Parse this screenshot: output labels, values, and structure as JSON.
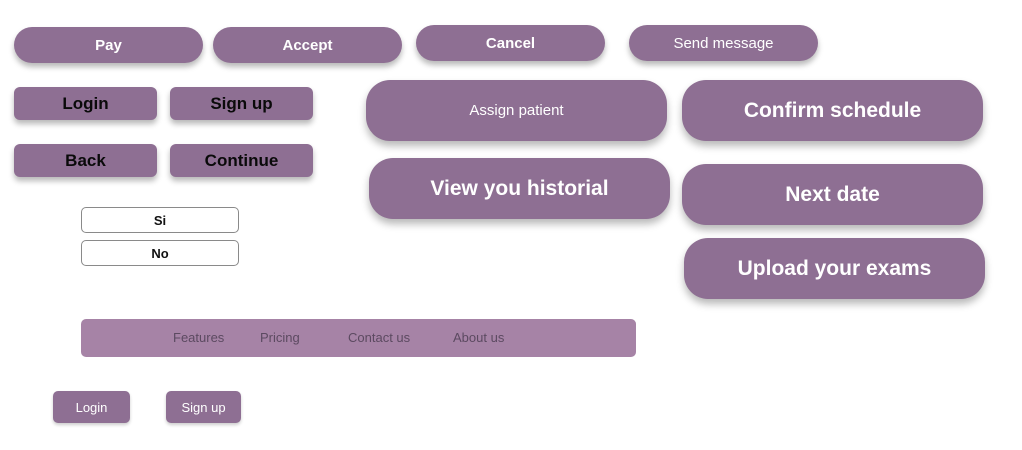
{
  "colors": {
    "button_fill": "#8e6f93",
    "navbar_fill": "#a683a6",
    "nav_text": "#5c4a61"
  },
  "top_row": {
    "pay": "Pay",
    "accept": "Accept",
    "cancel": "Cancel",
    "send_message": "Send message"
  },
  "auth": {
    "login": "Login",
    "signup": "Sign up",
    "back": "Back",
    "continue": "Continue"
  },
  "choices": {
    "yes": "Si",
    "no": "No"
  },
  "actions": {
    "assign_patient": "Assign patient",
    "view_historial": "View you historial",
    "confirm_schedule": "Confirm schedule",
    "next_date": "Next date",
    "upload_exams": "Upload your exams"
  },
  "navbar": {
    "items": [
      "Features",
      "Pricing",
      "Contact us",
      "About us"
    ]
  },
  "footer_auth": {
    "login": "Login",
    "signup": "Sign up"
  }
}
